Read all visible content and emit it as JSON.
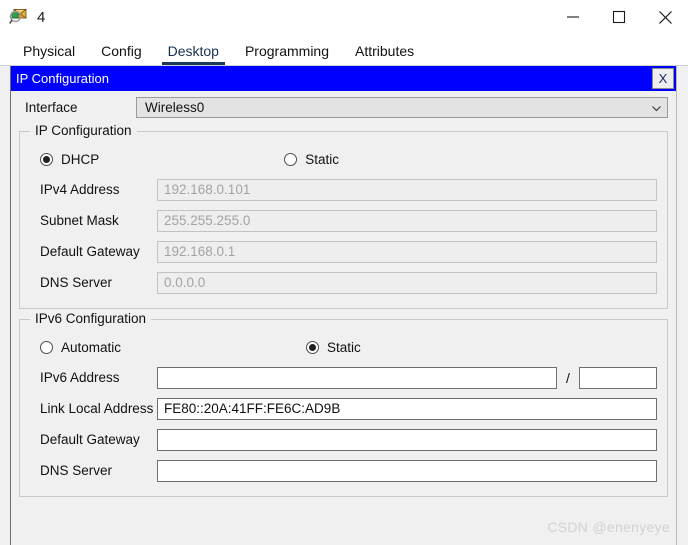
{
  "window": {
    "title": "4",
    "icon": "inspect-magnifier-icon",
    "minimize_label": "minimize-icon",
    "maximize_label": "maximize-icon",
    "close_label": "close-icon"
  },
  "tabs": [
    {
      "label": "Physical",
      "active": false
    },
    {
      "label": "Config",
      "active": false
    },
    {
      "label": "Desktop",
      "active": true
    },
    {
      "label": "Programming",
      "active": false
    },
    {
      "label": "Attributes",
      "active": false
    }
  ],
  "ip_window": {
    "title": "IP Configuration",
    "close_label": "X",
    "title_bg": "#0000FF",
    "title_fg": "#FFFFFF"
  },
  "interface": {
    "label": "Interface",
    "value": "Wireless0",
    "chevron": "chevron-down-icon"
  },
  "ipv4": {
    "legend": "IP Configuration",
    "mode_options": [
      "DHCP",
      "Static"
    ],
    "selected_mode": "DHCP",
    "dhcp_label": "DHCP",
    "static_label": "Static",
    "fields": [
      {
        "label": "IPv4 Address",
        "value": "192.168.0.101",
        "enabled": false
      },
      {
        "label": "Subnet Mask",
        "value": "255.255.255.0",
        "enabled": false
      },
      {
        "label": "Default Gateway",
        "value": "192.168.0.1",
        "enabled": false
      },
      {
        "label": "DNS Server",
        "value": "0.0.0.0",
        "enabled": false
      }
    ]
  },
  "ipv6": {
    "legend": "IPv6 Configuration",
    "mode_options": [
      "Automatic",
      "Static"
    ],
    "selected_mode": "Static",
    "automatic_label": "Automatic",
    "static_label": "Static",
    "address_label": "IPv6 Address",
    "address_value": "",
    "prefix_separator": "/",
    "prefix_value": "",
    "link_local_label": "Link Local Address",
    "link_local_value": "FE80::20A:41FF:FE6C:AD9B",
    "gateway_label": "Default Gateway",
    "gateway_value": "",
    "dns_label": "DNS Server",
    "dns_value": ""
  },
  "watermark": {
    "text": "CSDN @enenyeye"
  }
}
